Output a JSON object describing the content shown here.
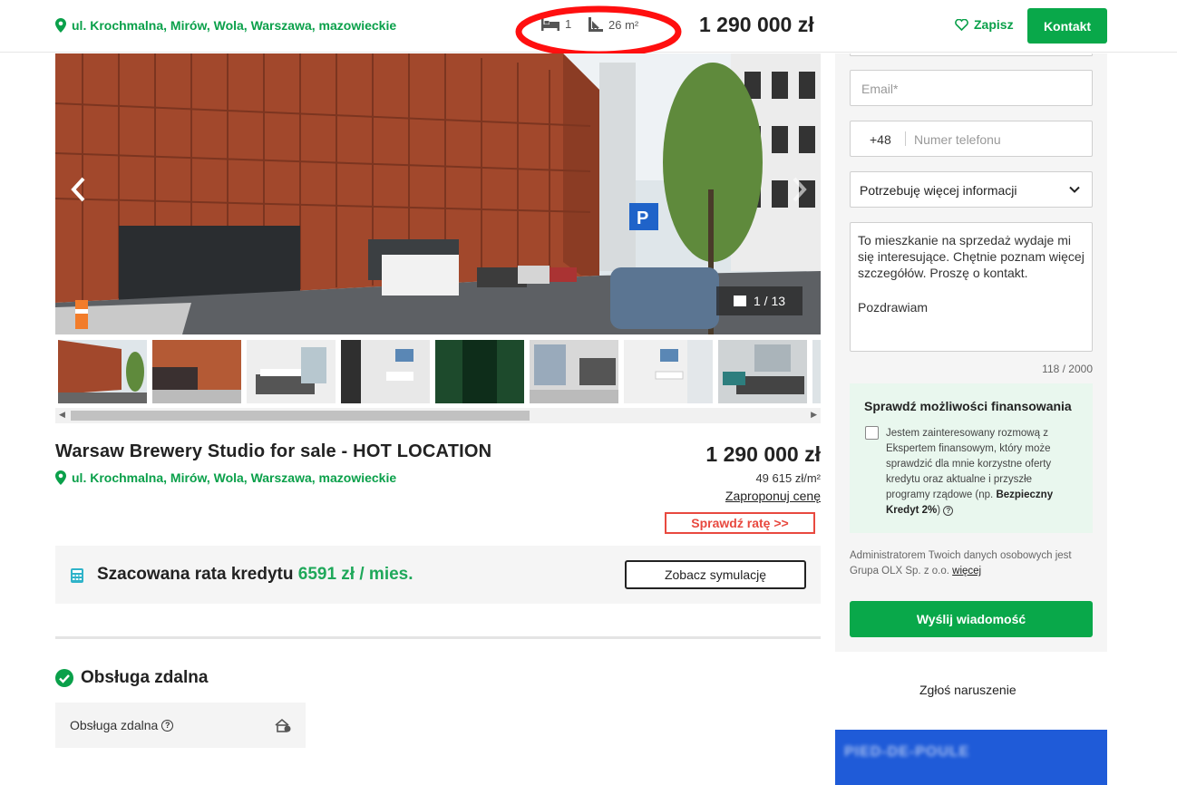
{
  "topbar": {
    "location": "ul. Krochmalna, Mirów, Wola, Warszawa, mazowieckie",
    "rooms": "1",
    "area": "26 m²",
    "price": "1 290 000 zł",
    "save_label": "Zapisz",
    "contact_label": "Kontakt"
  },
  "gallery": {
    "counter": "1 / 13",
    "prev_icon": "chevron-left-icon",
    "next_icon": "chevron-right-icon"
  },
  "listing": {
    "title": "Warsaw Brewery Studio for sale - HOT LOCATION",
    "location": "ul. Krochmalna, Mirów, Wola, Warszawa, mazowieckie",
    "price": "1 290 000 zł",
    "price_per_m2": "49 615 zł/m²",
    "offer_link": "Zaproponuj cenę",
    "rate_button": "Sprawdź ratę >>"
  },
  "credit": {
    "label": "Szacowana rata kredytu",
    "amount": "6591 zł / mies.",
    "simulation_button": "Zobacz symulację"
  },
  "remote": {
    "heading": "Obsługa zdalna",
    "item_label": "Obsługa zdalna"
  },
  "form": {
    "email_placeholder": "Email*",
    "phone_prefix": "+48",
    "phone_placeholder": "Numer telefonu",
    "topic_selected": "Potrzebuję więcej informacji",
    "message_line1": "To mieszkanie na sprzedaż wydaje mi się interesujące. Chętnie poznam więcej szczegółów. Proszę o kontakt.",
    "message_line2": "Pozdrawiam",
    "char_counter": "118 / 2000",
    "finance_heading": "Sprawdź możliwości finansowania",
    "finance_text": "Jestem zainteresowany rozmową z Ekspertem finansowym, który może sprawdzić dla mnie korzystne oferty kredytu oraz aktualne i przyszłe programy rządowe (np.",
    "finance_bold": "Bezpieczny Kredyt 2%",
    "finance_close": ")",
    "admin_text": "Administratorem Twoich danych osobowych jest Grupa OLX Sp. z o.o.",
    "admin_link": "więcej",
    "send_button": "Wyślij wiadomość"
  },
  "sidebar": {
    "report_link": "Zgłoś naruszenie",
    "ad_text": "PIED-DE-POULE"
  },
  "colors": {
    "brand_green": "#09a84a",
    "accent_red": "#e8493f"
  }
}
